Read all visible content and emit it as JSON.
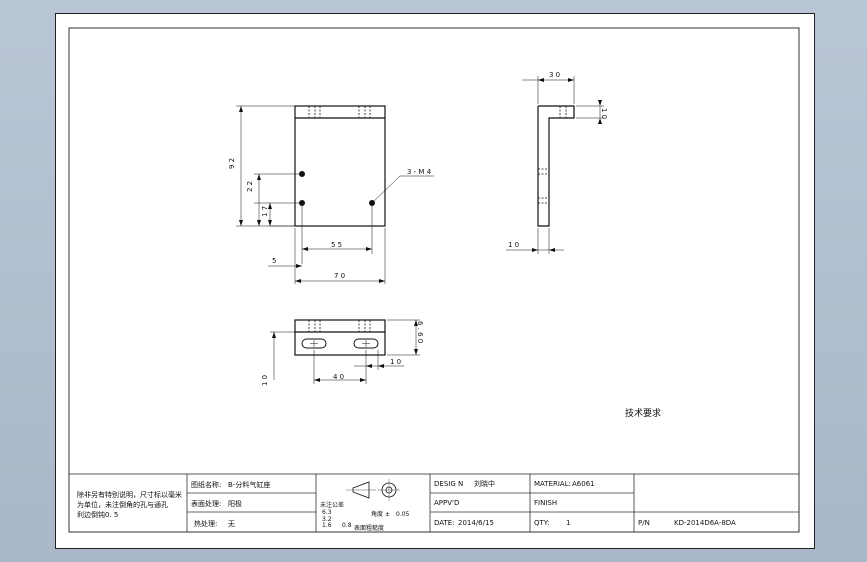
{
  "front_view": {
    "dim_height": "9 2",
    "dim_hole_y1": "2 2",
    "dim_hole_y2": "1 7",
    "dim_hole_spacing": "5 5",
    "dim_edge": "5",
    "dim_width": "7 0",
    "hole_callout": "3 - M 4"
  },
  "side_view": {
    "dim_top": "3 0",
    "dim_flange": "1 0",
    "dim_thickness": "1 0"
  },
  "bottom_view": {
    "dim_height": "6 . 6 0",
    "dim_slot_right": "1 0",
    "dim_slot_left": "1 0",
    "dim_slot_spacing": "4 0"
  },
  "tech_requirements": "技术要求",
  "title_block": {
    "notes": [
      "除非另有特别说明，尺寸标以毫米",
      "为单位，未注倒角的孔与通孔",
      "利边倒钝0. 5"
    ],
    "part_name_label": "图纸名称:",
    "part_name_value": "B-分料气缸座",
    "surface_label": "表面处理:",
    "surface_value": "阳极",
    "heat_label": "热处理:",
    "heat_value": "无",
    "roughness_label": "表面粗糙度",
    "roughness_values": [
      "6.3",
      "3.2",
      "1.6",
      "0.8"
    ],
    "flatness_label": "角度 ±",
    "flatness_value": "0.05",
    "tolerance_label": "未注公差",
    "design_label": "DESIG N",
    "design_value": "刘晓中",
    "material_label": "MATERIAL:",
    "material_value": "A6061",
    "approved_label": "APPV'D",
    "finish_label": "FINISH",
    "date_label": "DATE:",
    "date_value": "2014/6/15",
    "qty_label": "QTY:",
    "qty_value": "1",
    "pn_label": "P/N",
    "pn_value": "KD-2014D6A-8DA"
  }
}
